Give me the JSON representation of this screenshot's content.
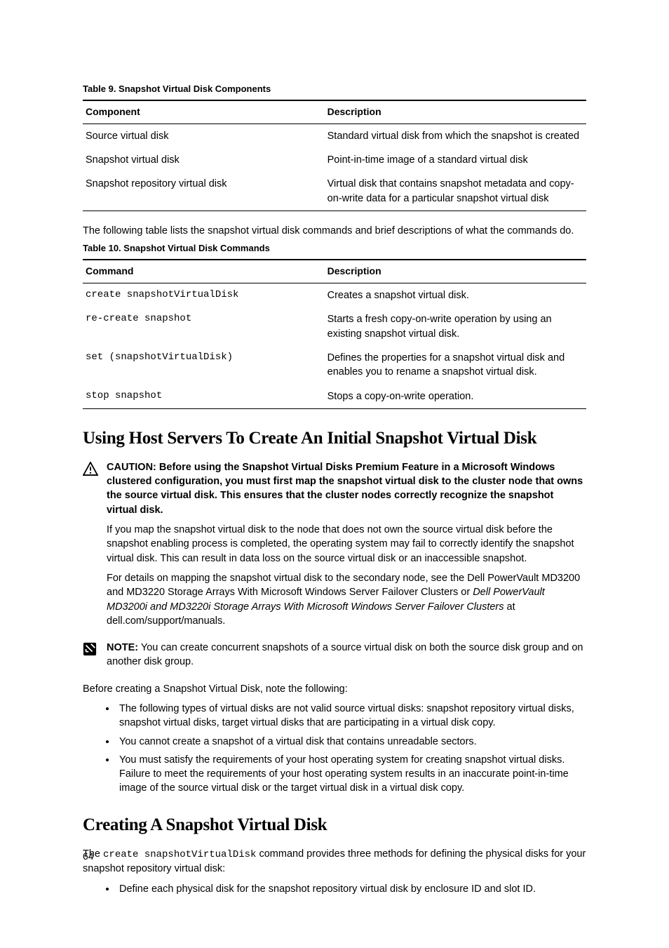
{
  "table9": {
    "caption": "Table 9. Snapshot Virtual Disk Components",
    "headers": [
      "Component",
      "Description"
    ],
    "rows": [
      {
        "c": "Source virtual disk",
        "d": "Standard virtual disk from which the snapshot is created"
      },
      {
        "c": "Snapshot virtual disk",
        "d": "Point-in-time image of a standard virtual disk"
      },
      {
        "c": "Snapshot repository virtual disk",
        "d": "Virtual disk that contains snapshot metadata and copy-on-write data for a particular snapshot virtual disk"
      }
    ]
  },
  "para_intro10": "The following table lists the snapshot virtual disk commands and brief descriptions of what the commands do.",
  "table10": {
    "caption": "Table 10. Snapshot Virtual Disk Commands",
    "headers": [
      "Command",
      "Description"
    ],
    "rows": [
      {
        "c": "create snapshotVirtualDisk",
        "d": "Creates a snapshot virtual disk."
      },
      {
        "c": "re-create snapshot",
        "d": "Starts a fresh copy-on-write operation by using an existing snapshot virtual disk."
      },
      {
        "c": "set (snapshotVirtualDisk)",
        "d": "Defines the properties for a snapshot virtual disk and enables you to rename a snapshot virtual disk."
      },
      {
        "c": "stop snapshot",
        "d": "Stops a copy-on-write operation."
      }
    ]
  },
  "heading1": "Using Host Servers To Create An Initial Snapshot Virtual Disk",
  "caution": {
    "label": "CAUTION:",
    "text": "Before using the Snapshot Virtual Disks Premium Feature in a Microsoft Windows clustered configuration, you must first map the snapshot virtual disk to the cluster node that owns the source virtual disk. This ensures that the cluster nodes correctly recognize the snapshot virtual disk."
  },
  "caution_p1": "If you map the snapshot virtual disk to the node that does not own the source virtual disk before the snapshot enabling process is completed, the operating system may fail to correctly identify the snapshot virtual disk. This can result in data loss on the source virtual disk or an inaccessible snapshot.",
  "caution_p2_pre": "For details on mapping the snapshot virtual disk to the secondary node, see the Dell PowerVault MD3200 and MD3220 Storage Arrays With Microsoft Windows Server Failover Clusters or ",
  "caution_p2_italic": "Dell PowerVault MD3200i and MD3220i Storage Arrays With Microsoft Windows Server Failover Clusters",
  "caution_p2_post": " at dell.com/support/manuals.",
  "note": {
    "label": "NOTE:",
    "text": "You can create concurrent snapshots of a source virtual disk on both the source disk group and on another disk group."
  },
  "before_para": "Before creating a Snapshot Virtual Disk, note the following:",
  "before_bullets": [
    "The following types of virtual disks are not valid source virtual disks: snapshot repository virtual disks, snapshot virtual disks, target virtual disks that are participating in a virtual disk copy.",
    "You cannot create a snapshot of a virtual disk that contains unreadable sectors.",
    "You must satisfy the requirements of your host operating system for creating snapshot virtual disks. Failure to meet the requirements of your host operating system results in an inaccurate point-in-time image of the source virtual disk or the target virtual disk in a virtual disk copy."
  ],
  "heading2": "Creating A Snapshot Virtual Disk",
  "creating_p_pre": "The ",
  "creating_p_code": "create snapshotVirtualDisk",
  "creating_p_post": " command provides three methods for defining the physical disks for your snapshot repository virtual disk:",
  "creating_bullets": [
    "Define each physical disk for the snapshot repository virtual disk by enclosure ID and slot ID."
  ],
  "page_number": "64"
}
